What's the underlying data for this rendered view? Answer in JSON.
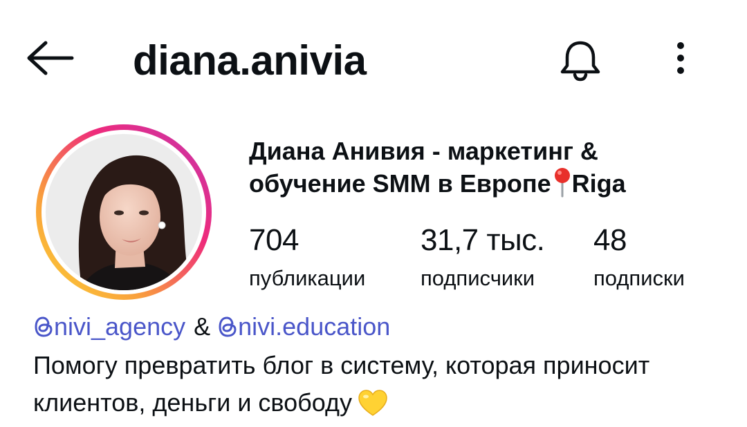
{
  "header": {
    "username": "diana.anivia",
    "back_icon": "arrow-left-icon",
    "notifications_icon": "bell-icon",
    "more_icon": "more-vertical-icon"
  },
  "profile": {
    "display_name_part1": "Диана Анивия - маркетинг & обучение SMM в Европе",
    "display_name_part2": "Riga",
    "pin_icon": "round-pushpin-emoji",
    "story_ring_colors": [
      "#fcaf45",
      "#f77737",
      "#e1306c",
      "#c13584"
    ]
  },
  "stats": {
    "posts": {
      "value": "704",
      "label": "публикации"
    },
    "followers": {
      "value": "31,7 тыс.",
      "label": "подписчики"
    },
    "following": {
      "value": "48",
      "label": "подписки"
    }
  },
  "links": {
    "link1": "nivi_agency",
    "separator": "&",
    "link2": "nivi.education",
    "link_icon": "threads-icon",
    "link_color": "#4a56c9"
  },
  "bio": {
    "text": "Помогу превратить блог в систему, которая приносит клиентов, деньги и свободу",
    "heart_icon": "yellow-heart-emoji"
  }
}
